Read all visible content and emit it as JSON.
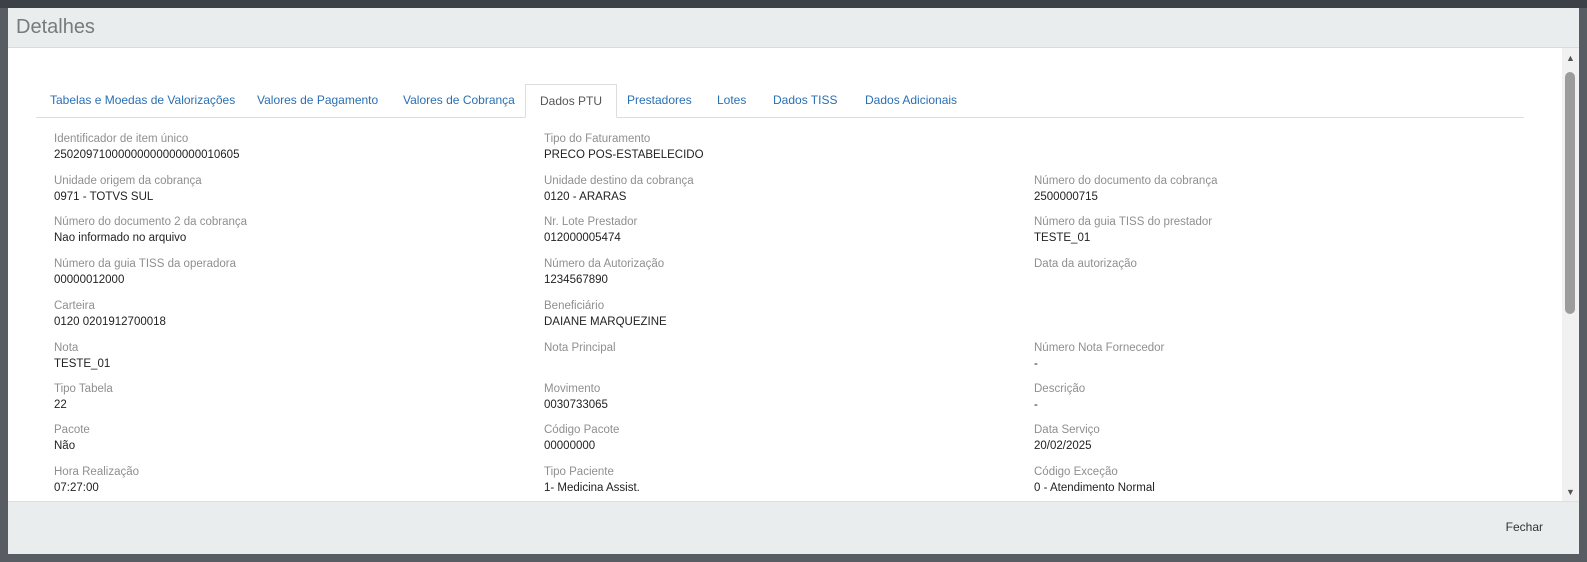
{
  "modal": {
    "title": "Detalhes",
    "close_label": "Fechar"
  },
  "tabs": [
    {
      "label": "Tabelas e Moedas de Valorizações"
    },
    {
      "label": "Valores de Pagamento"
    },
    {
      "label": "Valores de Cobrança"
    },
    {
      "label": "Dados PTU",
      "active": true
    },
    {
      "label": "Prestadores"
    },
    {
      "label": "Lotes"
    },
    {
      "label": "Dados TISS"
    },
    {
      "label": "Dados Adicionais"
    }
  ],
  "fields": {
    "identificador_item": {
      "label": "Identificador de item único",
      "value": "25020971000000000000000010605"
    },
    "tipo_faturamento": {
      "label": "Tipo do Faturamento",
      "value": "PRECO POS-ESTABELECIDO"
    },
    "unidade_origem": {
      "label": "Unidade origem da cobrança",
      "value": "0971 - TOTVS SUL"
    },
    "unidade_destino": {
      "label": "Unidade destino da cobrança",
      "value": "0120 - ARARAS"
    },
    "numero_documento": {
      "label": "Número do documento da cobrança",
      "value": "2500000715"
    },
    "numero_documento_2": {
      "label": "Número do documento 2 da cobrança",
      "value": "Nao informado no arquivo"
    },
    "nr_lote_prestador": {
      "label": "Nr. Lote Prestador",
      "value": "012000005474"
    },
    "guia_tiss_prestador": {
      "label": "Número da guia TISS do prestador",
      "value": "TESTE_01"
    },
    "guia_tiss_operadora": {
      "label": "Número da guia TISS da operadora",
      "value": "00000012000"
    },
    "numero_autorizacao": {
      "label": "Número da Autorização",
      "value": "1234567890"
    },
    "data_autorizacao": {
      "label": "Data da autorização",
      "value": ""
    },
    "carteira": {
      "label": "Carteira",
      "value": "0120 0201912700018"
    },
    "beneficiario": {
      "label": "Beneficiário",
      "value": "DAIANE MARQUEZINE"
    },
    "nota": {
      "label": "Nota",
      "value": "TESTE_01"
    },
    "nota_principal": {
      "label": "Nota Principal",
      "value": ""
    },
    "numero_nota_fornecedor": {
      "label": "Número Nota Fornecedor",
      "value": "-"
    },
    "tipo_tabela": {
      "label": "Tipo Tabela",
      "value": "22"
    },
    "movimento": {
      "label": "Movimento",
      "value": "0030733065"
    },
    "descricao": {
      "label": "Descrição",
      "value": "-"
    },
    "pacote": {
      "label": "Pacote",
      "value": "Não"
    },
    "codigo_pacote": {
      "label": "Código Pacote",
      "value": "00000000"
    },
    "data_servico": {
      "label": "Data Serviço",
      "value": "20/02/2025"
    },
    "hora_realizacao": {
      "label": "Hora Realização",
      "value": "07:27:00"
    },
    "tipo_paciente": {
      "label": "Tipo Paciente",
      "value": "1- Medicina Assist."
    },
    "codigo_excecao": {
      "label": "Código Exceção",
      "value": "0 - Atendimento Normal"
    }
  }
}
